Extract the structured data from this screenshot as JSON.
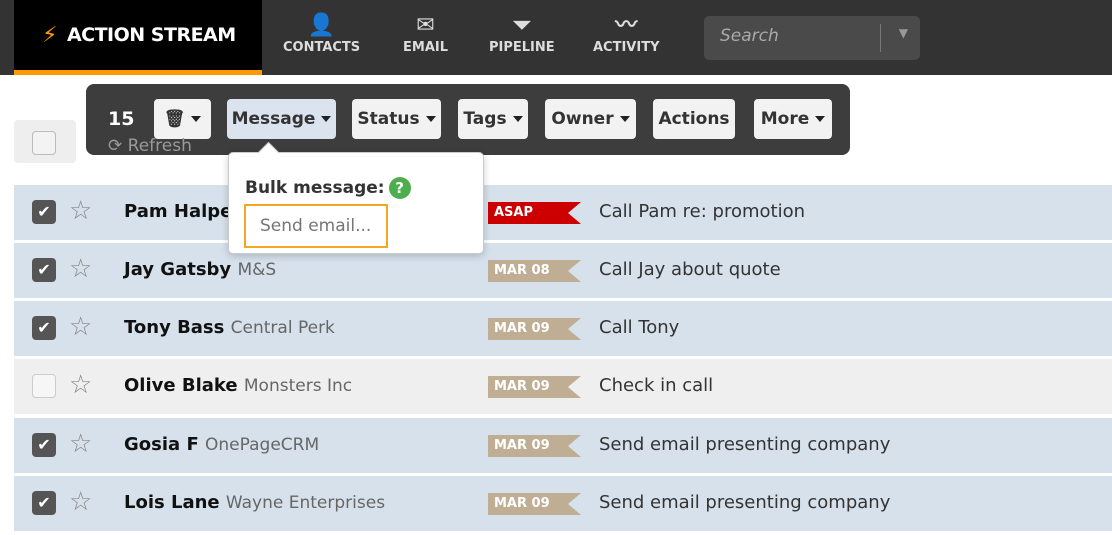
{
  "nav": {
    "brand": "ACTION STREAM",
    "items": [
      {
        "label": "CONTACTS",
        "icon": "person-icon"
      },
      {
        "label": "EMAIL",
        "icon": "envelope-icon"
      },
      {
        "label": "PIPELINE",
        "icon": "funnel-icon"
      },
      {
        "label": "ACTIVITY",
        "icon": "pulse-icon"
      }
    ],
    "search_placeholder": "Search"
  },
  "refresh": "⟳ Refresh",
  "toolbar": {
    "count": "15",
    "buttons": [
      "Message",
      "Status",
      "Tags",
      "Owner",
      "Actions",
      "More"
    ]
  },
  "popover": {
    "label": "Bulk message:",
    "placeholder": "Send email..."
  },
  "colors": {
    "accent": "#ff9900",
    "asap": "#cc0000",
    "date_tag": "#bfae94",
    "selected_row": "#d6e1ec"
  },
  "rows": [
    {
      "name": "Pam Halpert",
      "company": "",
      "tag": "ASAP",
      "task": "Call Pam re: promotion",
      "checked": true
    },
    {
      "name": "Jay Gatsby",
      "company": "M&S",
      "tag": "MAR 08",
      "task": "Call Jay about quote",
      "checked": true
    },
    {
      "name": "Tony Bass",
      "company": "Central Perk",
      "tag": "MAR 09",
      "task": "Call Tony",
      "checked": true
    },
    {
      "name": "Olive Blake",
      "company": "Monsters Inc",
      "tag": "MAR 09",
      "task": "Check in call",
      "checked": false
    },
    {
      "name": "Gosia F",
      "company": "OnePageCRM",
      "tag": "MAR 09",
      "task": "Send email presenting company",
      "checked": true
    },
    {
      "name": "Lois Lane",
      "company": "Wayne Enterprises",
      "tag": "MAR 09",
      "task": "Send email presenting company",
      "checked": true
    }
  ]
}
